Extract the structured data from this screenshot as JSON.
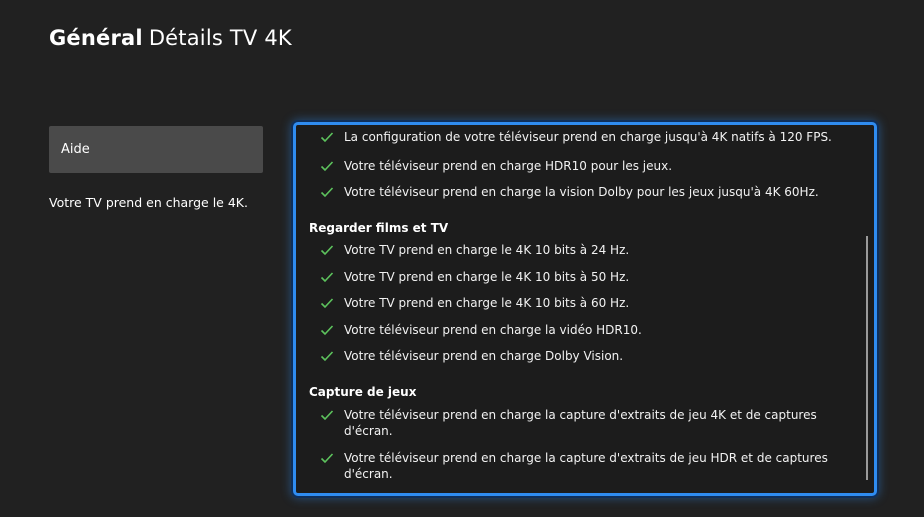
{
  "header": {
    "section": "Général",
    "page": "Détails TV 4K"
  },
  "sidebar": {
    "help_button_label": "Aide",
    "help_text": "Votre TV prend en charge le 4K."
  },
  "panel": {
    "items_top": [
      "La configuration de votre téléviseur prend en charge jusqu'à 4K natifs à 120 FPS.",
      "Votre téléviseur prend en charge HDR10 pour les jeux.",
      "Votre téléviseur prend en charge la vision Dolby pour les jeux jusqu'à 4K 60Hz."
    ],
    "sections": [
      {
        "heading": "Regarder films et TV",
        "items": [
          "Votre TV prend en charge le 4K 10 bits à 24 Hz.",
          "Votre TV prend en charge le 4K 10 bits à 50 Hz.",
          "Votre TV prend en charge le 4K 10 bits à 60 Hz.",
          "Votre téléviseur prend en charge la vidéo HDR10.",
          "Votre téléviseur prend en charge Dolby Vision."
        ]
      },
      {
        "heading": "Capture de jeux",
        "items": [
          "Votre téléviseur prend en charge la capture d'extraits de jeu 4K et de captures d'écran.",
          "Votre téléviseur prend en charge la capture d'extraits de jeu HDR et de captures d'écran."
        ]
      }
    ]
  },
  "colors": {
    "focus_border": "#2f8cf0",
    "check": "#5dc35d",
    "background": "#212121",
    "button": "#4a4a4a"
  },
  "icons": {
    "check": "check-icon"
  }
}
